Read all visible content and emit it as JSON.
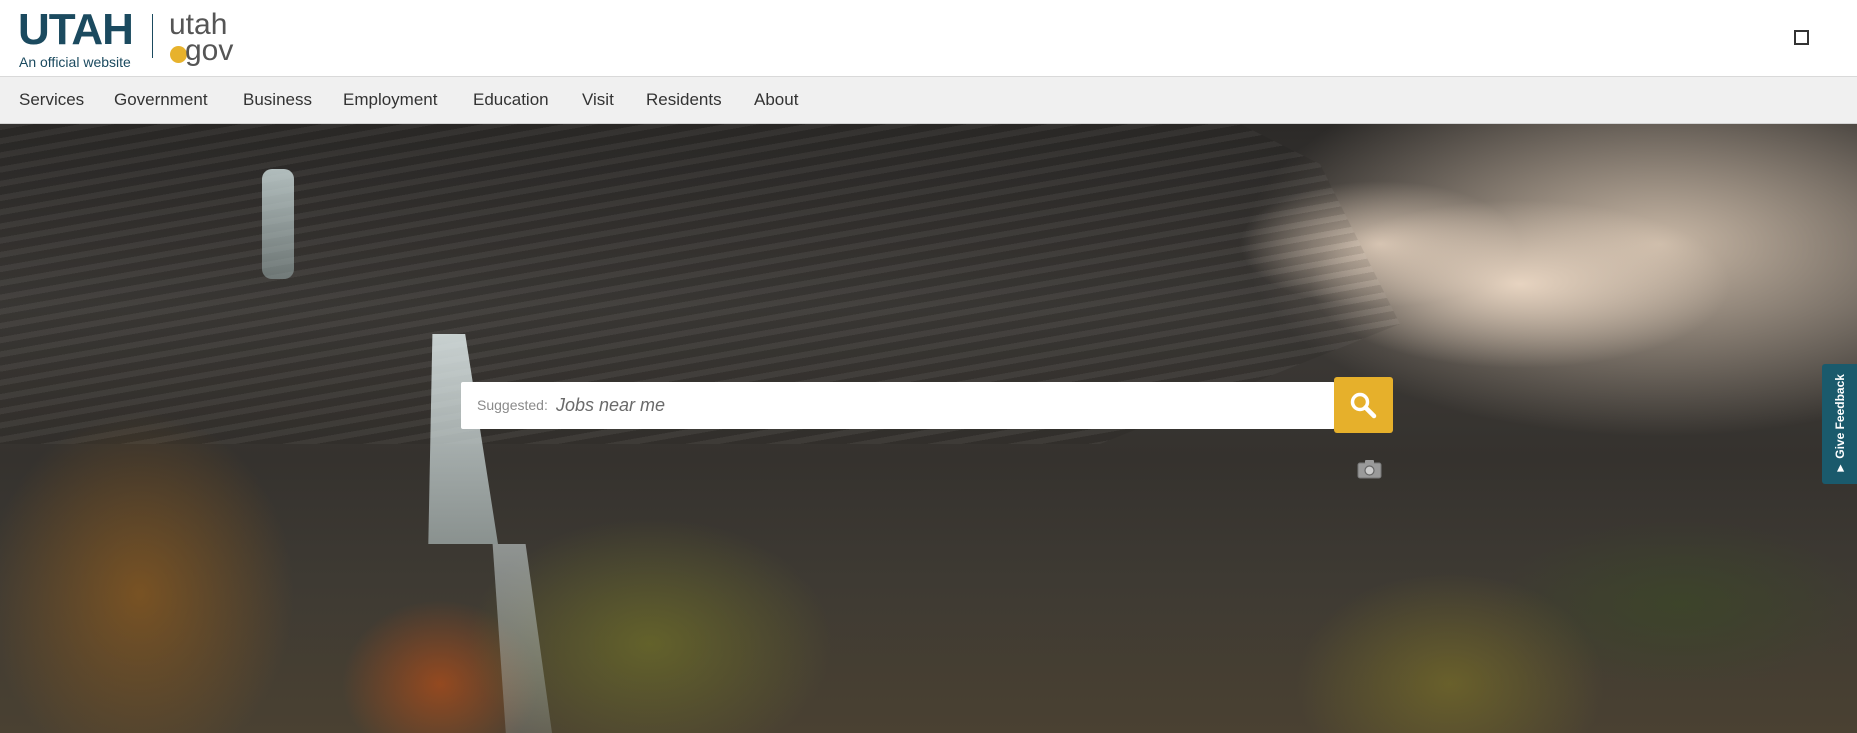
{
  "header": {
    "logo_text": "UTAH",
    "logo_subtitle": "An official website",
    "utahgov_top": "utah",
    "utahgov_bottom": "gov",
    "menu_icon": "square-icon"
  },
  "nav": {
    "items": [
      {
        "label": "Services"
      },
      {
        "label": "Government"
      },
      {
        "label": "Business"
      },
      {
        "label": "Employment"
      },
      {
        "label": "Education"
      },
      {
        "label": "Visit"
      },
      {
        "label": "Residents"
      },
      {
        "label": "About"
      }
    ]
  },
  "search": {
    "suggested_label": "Suggested:",
    "placeholder": "Jobs near me",
    "button_icon": "search-icon"
  },
  "feedback": {
    "label": "Give Feedback",
    "icon": "megaphone-icon"
  },
  "colors": {
    "brand_blue": "#1b4a5f",
    "accent_gold": "#e6b02b",
    "feedback_teal": "#1a5a6c"
  }
}
